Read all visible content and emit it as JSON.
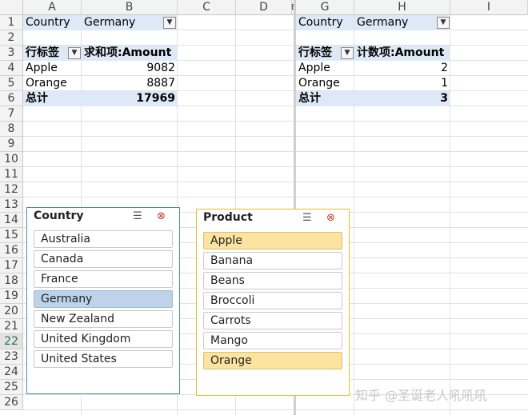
{
  "columns": [
    "A",
    "B",
    "C",
    "D",
    "E",
    "G",
    "H",
    "I"
  ],
  "rows": [
    "1",
    "2",
    "3",
    "4",
    "5",
    "6",
    "7",
    "8",
    "9",
    "10",
    "11",
    "12",
    "13",
    "14",
    "15",
    "16",
    "17",
    "18",
    "19",
    "20",
    "21",
    "22",
    "23",
    "24",
    "25",
    "26"
  ],
  "pivot_left": {
    "filter_field": "Country",
    "filter_value": "Germany",
    "row_label": "行标签",
    "value_header": "求和项:Amount",
    "items": [
      {
        "label": "Apple",
        "value": "9082"
      },
      {
        "label": "Orange",
        "value": "8887"
      }
    ],
    "total_label": "总计",
    "total_value": "17969"
  },
  "pivot_right": {
    "filter_field": "Country",
    "filter_value": "Germany",
    "row_label": "行标签",
    "value_header": "计数项:Amount",
    "items": [
      {
        "label": "Apple",
        "value": "2"
      },
      {
        "label": "Orange",
        "value": "1"
      }
    ],
    "total_label": "总计",
    "total_value": "3"
  },
  "slicer_country": {
    "title": "Country",
    "items": [
      "Australia",
      "Canada",
      "France",
      "Germany",
      "New Zealand",
      "United Kingdom",
      "United States"
    ],
    "selected": "Germany"
  },
  "slicer_product": {
    "title": "Product",
    "items": [
      "Apple",
      "Banana",
      "Beans",
      "Broccoli",
      "Carrots",
      "Mango",
      "Orange"
    ],
    "selected": [
      "Apple",
      "Orange"
    ]
  },
  "watermark": "知乎 @圣诞老人吼吼吼",
  "colors": {
    "header_bg": "#f3f3f3",
    "pivot_highlight": "#dde9f7",
    "slicer_country_border": "#4f87b8",
    "slicer_product_border": "#e3bf2a",
    "sel_blue": "#bcd3ea",
    "sel_gold": "#fce4a0"
  }
}
